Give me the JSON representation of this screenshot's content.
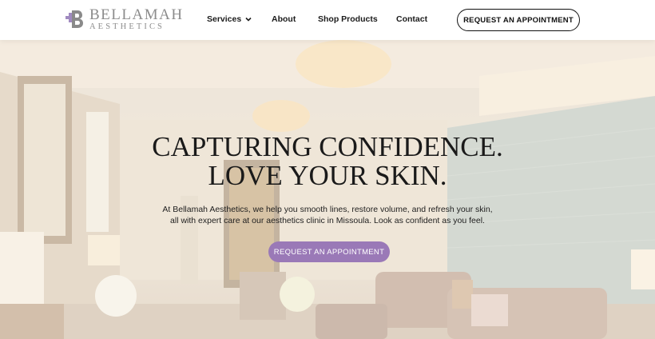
{
  "brand": {
    "name": "BELLAMAH",
    "tagline": "AESTHETICS",
    "accent_color": "#9a79b7"
  },
  "nav": {
    "items": [
      {
        "label": "Services",
        "has_dropdown": true
      },
      {
        "label": "About"
      },
      {
        "label": "Shop Products"
      },
      {
        "label": "Contact"
      }
    ],
    "cta_label": "REQUEST AN APPOINTMENT"
  },
  "hero": {
    "title_line1": "CAPTURING CONFIDENCE.",
    "title_line2": "LOVE YOUR SKIN.",
    "description_line1": "At Bellamah Aesthetics, we help you smooth lines, restore volume, and refresh your skin,",
    "description_line2": "all with expert care at our aesthetics clinic in Missoula. Look as confident as you feel.",
    "button_label": "REQUEST AN APPOINTMENT",
    "background_image": "clinic-waiting-room-photo"
  }
}
